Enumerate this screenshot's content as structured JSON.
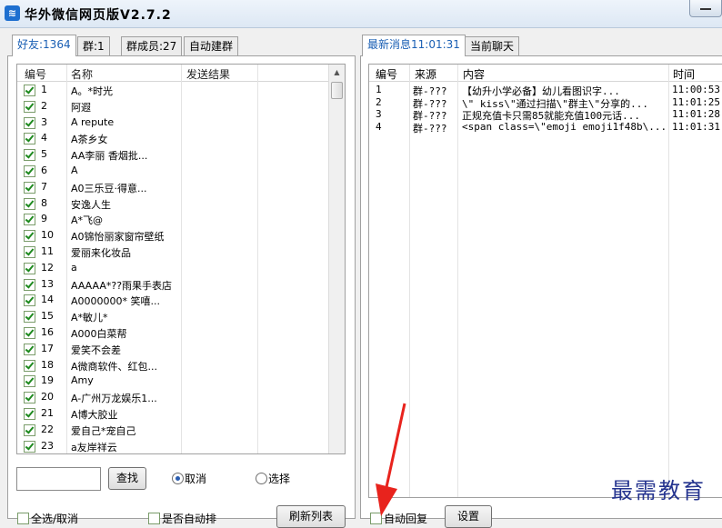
{
  "window": {
    "title": "华外微信网页版V2.7.2",
    "app_icon_glyph": "≋"
  },
  "left_tabs": [
    {
      "label": "好友:1364"
    },
    {
      "label": "群:1"
    },
    {
      "label": "群成员:27"
    },
    {
      "label": "自动建群"
    }
  ],
  "friends_table": {
    "headers": {
      "num": "编号",
      "name": "名称",
      "result": "发送结果"
    },
    "rows": [
      {
        "num": "1",
        "name": "A。*时光"
      },
      {
        "num": "2",
        "name": "阿遐"
      },
      {
        "num": "3",
        "name": "A   repute"
      },
      {
        "num": "4",
        "name": "A茶乡女"
      },
      {
        "num": "5",
        "name": "AA李丽  香烟批..."
      },
      {
        "num": "6",
        "name": "A"
      },
      {
        "num": "7",
        "name": "A0三乐豆·得意..."
      },
      {
        "num": "8",
        "name": "安逸人生"
      },
      {
        "num": "9",
        "name": "A*飞@"
      },
      {
        "num": "10",
        "name": "A0锦怡丽家窗帘壁纸"
      },
      {
        "num": "11",
        "name": "爱丽来化妆品"
      },
      {
        "num": "12",
        "name": "a"
      },
      {
        "num": "13",
        "name": "AAAAA*??雨果手表店"
      },
      {
        "num": "14",
        "name": "A0000000* 笑嘻..."
      },
      {
        "num": "15",
        "name": "A*敏儿*"
      },
      {
        "num": "16",
        "name": "A000白菜帮"
      },
      {
        "num": "17",
        "name": "爱笑不会差"
      },
      {
        "num": "18",
        "name": "A微商软件、红包..."
      },
      {
        "num": "19",
        "name": "Amy"
      },
      {
        "num": "20",
        "name": "A-广州万龙娱乐1..."
      },
      {
        "num": "21",
        "name": "A博大胶业"
      },
      {
        "num": "22",
        "name": "爱自己*宠自己"
      },
      {
        "num": "23",
        "name": "a友岸祥云"
      }
    ]
  },
  "search": {
    "value": "",
    "button": "查找"
  },
  "radios": {
    "cancel": "取消",
    "select": "选择"
  },
  "bottom_left": {
    "check_all": "全选/取消",
    "auto_sort": "是否自动排",
    "refresh": "刷新列表"
  },
  "right_tabs": [
    {
      "label": "最新消息11:01:31"
    },
    {
      "label": "当前聊天"
    }
  ],
  "messages_table": {
    "headers": {
      "num": "编号",
      "source": "来源",
      "content": "内容",
      "time": "时间"
    },
    "rows": [
      {
        "num": "1",
        "source": "群-???",
        "content": "  【幼升小学必备】幼儿看图识字...",
        "time": "11:00:53"
      },
      {
        "num": "2",
        "source": "群-???",
        "content": "\\\" kiss\\\"通过扫描\\\"群主\\\"分享的...",
        "time": "11:01:25"
      },
      {
        "num": "3",
        "source": "群-???",
        "content": "正规充值卡只需85就能充值100元话...",
        "time": "11:01:28"
      },
      {
        "num": "4",
        "source": "群-???",
        "content": "<span class=\\\"emoji emoji1f48b\\...",
        "time": "11:01:31"
      }
    ]
  },
  "bottom_right": {
    "auto_reply": "自动回复",
    "settings": "设置"
  },
  "watermark": "最需教育",
  "colors": {
    "active_tab": "#1a5fb4",
    "check_green": "#1e8a1e",
    "arrow_red": "#e8231d",
    "watermark": "#25348f"
  }
}
